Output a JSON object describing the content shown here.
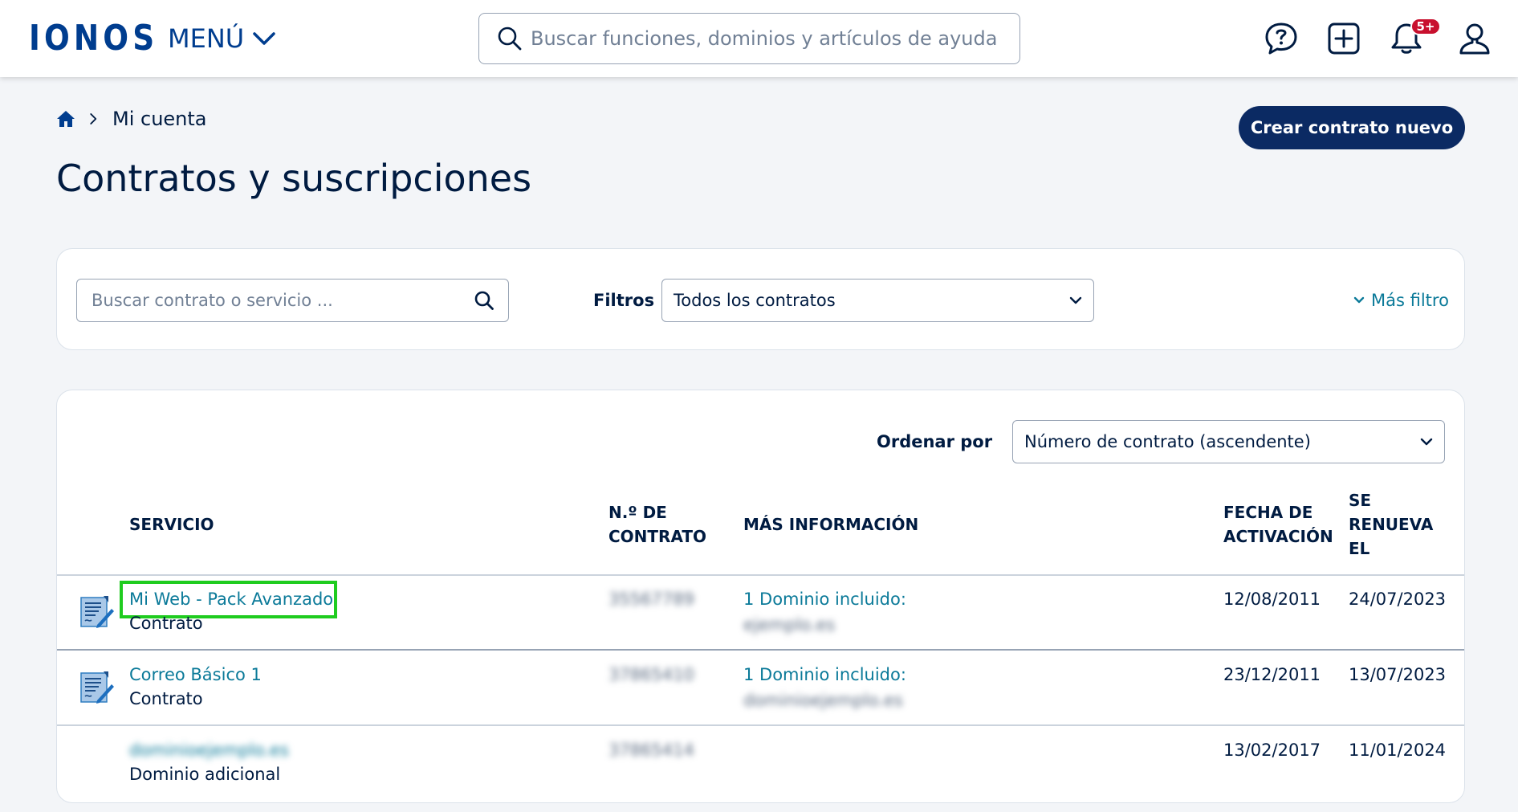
{
  "header": {
    "logo": "IONOS",
    "menu_label": "MENÚ",
    "search_placeholder": "Buscar funciones, dominios y artículos de ayuda",
    "notifications_badge": "5+",
    "brand_color": "#003d8f"
  },
  "breadcrumb": {
    "current": "Mi cuenta"
  },
  "page": {
    "title": "Contratos y suscripciones",
    "new_contract_button": "Crear contrato nuevo"
  },
  "filters": {
    "search_placeholder": "Buscar contrato o servicio ...",
    "label": "Filtros",
    "selected": "Todos los contratos",
    "more_filters": "Más filtro"
  },
  "sort": {
    "label": "Ordenar por",
    "selected": "Número de contrato (ascendente)"
  },
  "table": {
    "headers": {
      "service": "SERVICIO",
      "contract_no_1": "N.º DE",
      "contract_no_2": "CONTRATO",
      "more_info": "MÁS INFORMACIÓN",
      "activation_1": "FECHA DE",
      "activation_2": "ACTIVACIÓN",
      "renews_1": "SE",
      "renews_2": "RENUEVA",
      "renews_3": "EL"
    },
    "rows": [
      {
        "service": "Mi Web - Pack Avanzado",
        "type": "Contrato",
        "contract_number": "35567789",
        "info_label": "1 Dominio incluido:",
        "info_value": "ejemplo.es",
        "activation_date": "12/08/2011",
        "renewal_date": "24/07/2023"
      },
      {
        "service": "Correo Básico 1",
        "type": "Contrato",
        "contract_number": "37865410",
        "info_label": "1 Dominio incluido:",
        "info_value": "dominioejemplo.es",
        "activation_date": "23/12/2011",
        "renewal_date": "13/07/2023"
      },
      {
        "service": "dominioejemplo.es",
        "type": "Dominio adicional",
        "contract_number": "37865414",
        "info_label": "",
        "info_value": "",
        "activation_date": "13/02/2017",
        "renewal_date": "11/01/2024"
      }
    ]
  }
}
